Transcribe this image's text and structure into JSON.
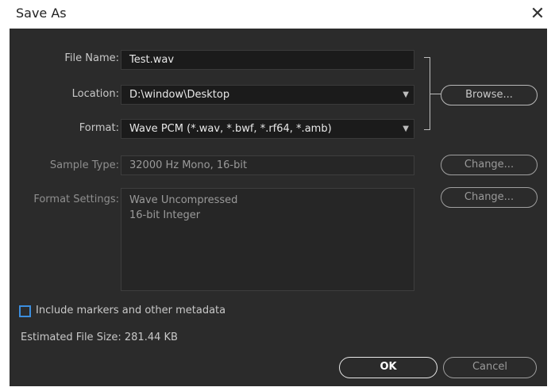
{
  "window": {
    "title": "Save As",
    "close_icon": "close-icon"
  },
  "form": {
    "file_name": {
      "label": "File Name:",
      "value": "Test.wav"
    },
    "location": {
      "label": "Location:",
      "value": "D:\\window\\Desktop",
      "browse_label": "Browse..."
    },
    "format": {
      "label": "Format:",
      "value": "Wave PCM (*.wav, *.bwf, *.rf64, *.amb)"
    },
    "sample_type": {
      "label": "Sample Type:",
      "value": "32000 Hz Mono, 16-bit",
      "change_label": "Change..."
    },
    "format_settings": {
      "label": "Format Settings:",
      "line1": "Wave Uncompressed",
      "line2": "16-bit Integer",
      "change_label": "Change..."
    },
    "include_markers": {
      "label": "Include markers and other metadata",
      "checked": false
    },
    "estimated_size": "Estimated File Size: 281.44 KB"
  },
  "footer": {
    "ok_label": "OK",
    "cancel_label": "Cancel"
  },
  "colors": {
    "panel": "#2b2b2b",
    "field": "#1b1b1b",
    "checkbox_accent": "#3c8ede"
  }
}
